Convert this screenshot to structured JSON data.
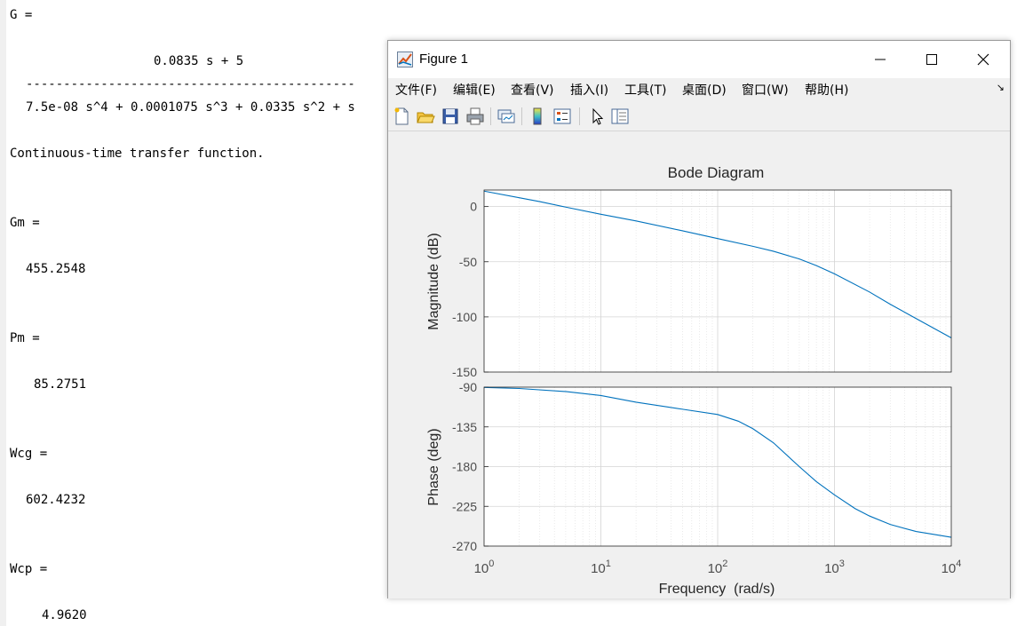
{
  "console": {
    "g_label": "G =",
    "numerator": "0.0835 s + 5",
    "fraction_bar": "--------------------------------------------",
    "denominator": "7.5e-08 s^4 + 0.0001075 s^3 + 0.0335 s^2 + s",
    "tf_note": "Continuous-time transfer function.",
    "gm_label": "Gm =",
    "gm_value": "455.2548",
    "pm_label": "Pm =",
    "pm_value": "85.2751",
    "wcg_label": "Wcg =",
    "wcg_value": "602.4232",
    "wcp_label": "Wcp =",
    "wcp_value": "4.9620"
  },
  "figure": {
    "title": "Figure 1",
    "window_buttons": {
      "minimize": "minimize-icon",
      "maximize": "maximize-icon",
      "close": "close-icon"
    },
    "menus": [
      "文件(F)",
      "编辑(E)",
      "查看(V)",
      "插入(I)",
      "工具(T)",
      "桌面(D)",
      "窗口(W)",
      "帮助(H)"
    ],
    "toolbar_icons": [
      "new-figure-icon",
      "open-file-icon",
      "save-icon",
      "print-icon",
      "link-plot-icon",
      "colorbar-icon",
      "legend-icon",
      "edit-plot-arrow-icon",
      "property-inspector-icon"
    ]
  },
  "chart_data": {
    "type": "line",
    "title": "Bode Diagram",
    "xlabel": "Frequency  (rad/s)",
    "xscale": "log",
    "xlim": [
      1,
      10000
    ],
    "xticks": [
      "10^0",
      "10^1",
      "10^2",
      "10^3",
      "10^4"
    ],
    "grid": true,
    "color": "#0072bd",
    "panels": [
      {
        "name": "magnitude",
        "ylabel": "Magnitude (dB)",
        "ylim": [
          -150,
          15
        ],
        "yticks": [
          0,
          -50,
          -100,
          -150
        ],
        "series": [
          {
            "x": [
              1,
              2,
              3,
              5,
              10,
              20,
              50,
              100,
              200,
              300,
              500,
              700,
              1000,
              2000,
              3000,
              5000,
              10000
            ],
            "y": [
              14,
              8,
              4.5,
              -0.5,
              -7,
              -13,
              -22,
              -29,
              -36,
              -40.5,
              -47.5,
              -53.5,
              -61,
              -77.5,
              -88.5,
              -101.5,
              -119
            ]
          }
        ]
      },
      {
        "name": "phase",
        "ylabel": "Phase (deg)",
        "ylim": [
          -270,
          -90
        ],
        "yticks": [
          -90,
          -135,
          -180,
          -225,
          -270
        ],
        "series": [
          {
            "x": [
              1,
              2,
              5,
              10,
              20,
              50,
              100,
              150,
              200,
              300,
              500,
              700,
              1000,
              1500,
              2000,
              3000,
              5000,
              10000
            ],
            "y": [
              -90.3,
              -91.5,
              -95,
              -99.5,
              -107,
              -115,
              -121,
              -128.5,
              -137,
              -153,
              -180,
              -197,
              -212,
              -227.5,
              -236,
              -245.5,
              -253.5,
              -260
            ]
          }
        ]
      }
    ]
  }
}
